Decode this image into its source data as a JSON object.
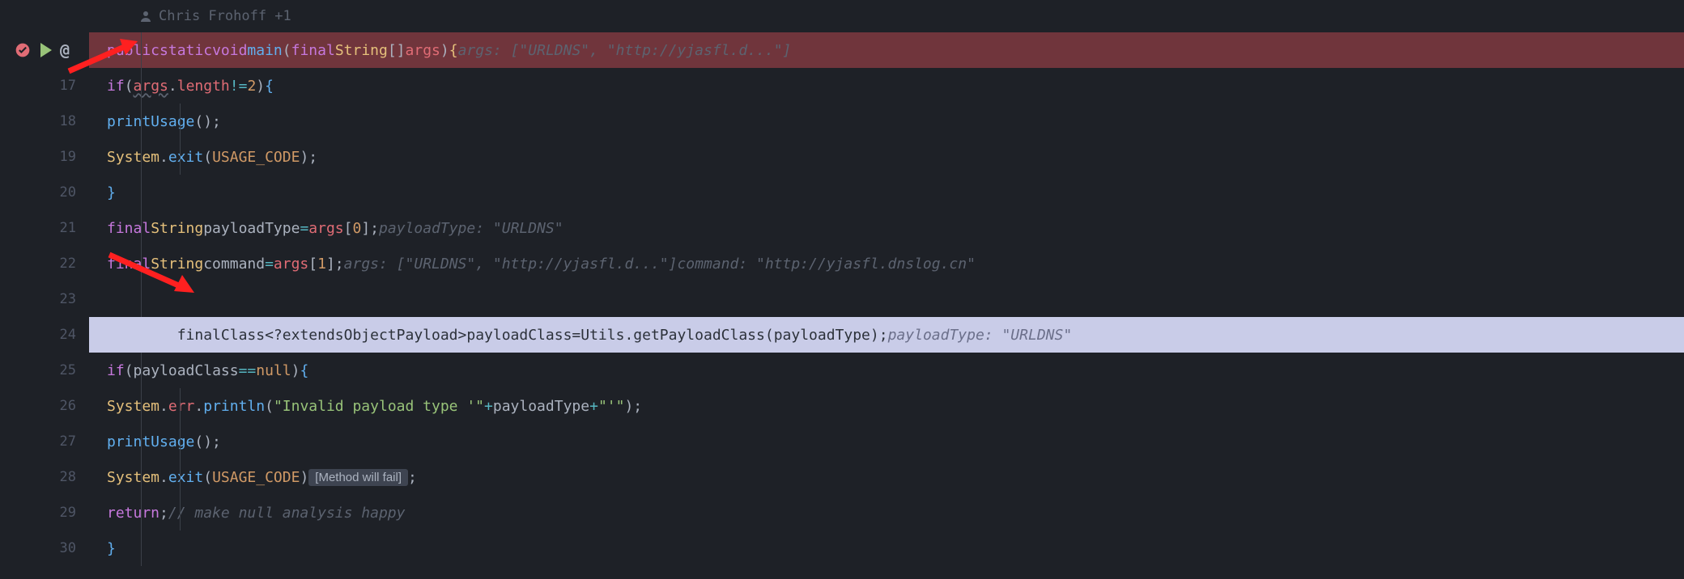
{
  "author": "Chris Frohoff +1",
  "gutter": {
    "icons_line": "",
    "lines": [
      "",
      "17",
      "18",
      "19",
      "20",
      "21",
      "22",
      "23",
      "24",
      "25",
      "26",
      "27",
      "28",
      "29",
      "30"
    ]
  },
  "code": {
    "l16": {
      "kw1": "public",
      "kw2": "static",
      "kw3": "void",
      "fn": "main",
      "kw4": "final",
      "type": "String",
      "arr": "[]",
      "arg": "args",
      "hint": "args: [\"URLDNS\", \"http://yjasfl.d...\"]"
    },
    "l17": {
      "kw": "if",
      "var": "args",
      "prop": "length",
      "op": "!=",
      "num": "2"
    },
    "l18": {
      "fn": "printUsage"
    },
    "l19": {
      "obj": "System",
      "fn": "exit",
      "const": "USAGE_CODE"
    },
    "l21": {
      "kw1": "final",
      "type": "String",
      "var": "payloadType",
      "op": "=",
      "arr": "args",
      "idx": "0",
      "hint": "payloadType: \"URLDNS\""
    },
    "l22": {
      "kw1": "final",
      "type": "String",
      "var": "command",
      "op": "=",
      "arr": "args",
      "idx": "1",
      "hint1": "args: [\"URLDNS\", \"http://yjasfl.d...\"]",
      "hint2": "command: \"http://yjasfl.dnslog.cn\""
    },
    "l24": {
      "kw1": "final",
      "type1": "Class",
      "wild": "<?",
      "kw2": "extends",
      "type2": "ObjectPayload",
      "close": ">",
      "var": "payloadClass",
      "op": "=",
      "cls": "Utils",
      "fn": "getPayloadClass",
      "arg": "payloadType",
      "hint": "payloadType: \"URLDNS\""
    },
    "l25": {
      "kw": "if",
      "var": "payloadClass",
      "op": "==",
      "null": "null"
    },
    "l26": {
      "obj": "System",
      "err": "err",
      "fn": "println",
      "s1": "\"Invalid payload type '\"",
      "op": "+",
      "v": "payloadType",
      "s2": "\"'\""
    },
    "l27": {
      "fn": "printUsage"
    },
    "l28": {
      "obj": "System",
      "fn": "exit",
      "const": "USAGE_CODE",
      "badge": "[Method will fail]"
    },
    "l29": {
      "kw": "return",
      "comment": "// make null analysis happy"
    }
  }
}
